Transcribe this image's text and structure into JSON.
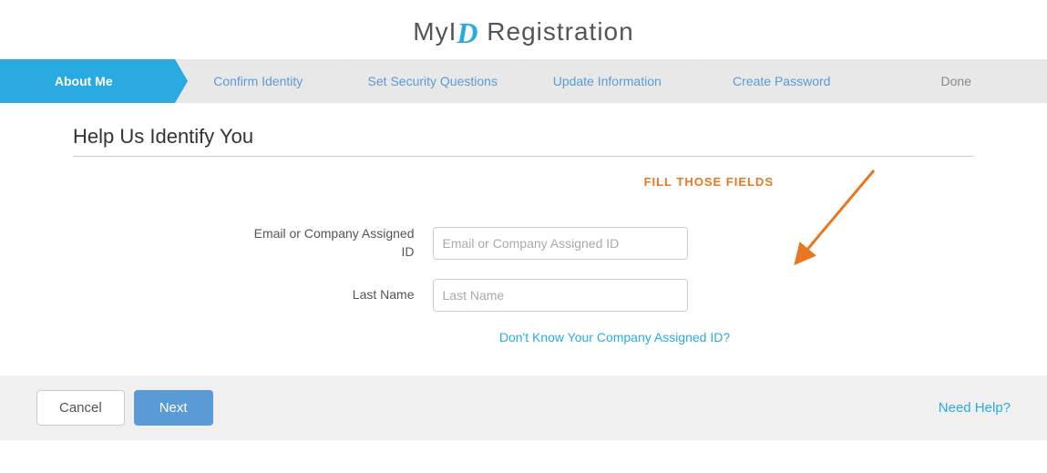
{
  "page": {
    "title_prefix": "MyI",
    "title_logo": "D",
    "title_suffix": " Registration"
  },
  "breadcrumb": {
    "items": [
      {
        "id": "about-me",
        "label": "About Me",
        "state": "active"
      },
      {
        "id": "confirm-identity",
        "label": "Confirm Identity",
        "state": "inactive"
      },
      {
        "id": "set-security-questions",
        "label": "Set Security Questions",
        "state": "inactive"
      },
      {
        "id": "update-information",
        "label": "Update Information",
        "state": "inactive"
      },
      {
        "id": "create-password",
        "label": "Create Password",
        "state": "inactive"
      },
      {
        "id": "done",
        "label": "Done",
        "state": "last"
      }
    ]
  },
  "main": {
    "section_title": "Help Us Identify You",
    "annotation_text": "FILL THOSE FIELDS",
    "form": {
      "email_label": "Email or Company Assigned ID",
      "email_placeholder": "Email or Company Assigned ID",
      "last_name_label": "Last Name",
      "last_name_placeholder": "Last Name",
      "forgot_link": "Don't Know Your Company Assigned ID?"
    }
  },
  "footer": {
    "cancel_label": "Cancel",
    "next_label": "Next",
    "need_help_label": "Need Help?"
  }
}
